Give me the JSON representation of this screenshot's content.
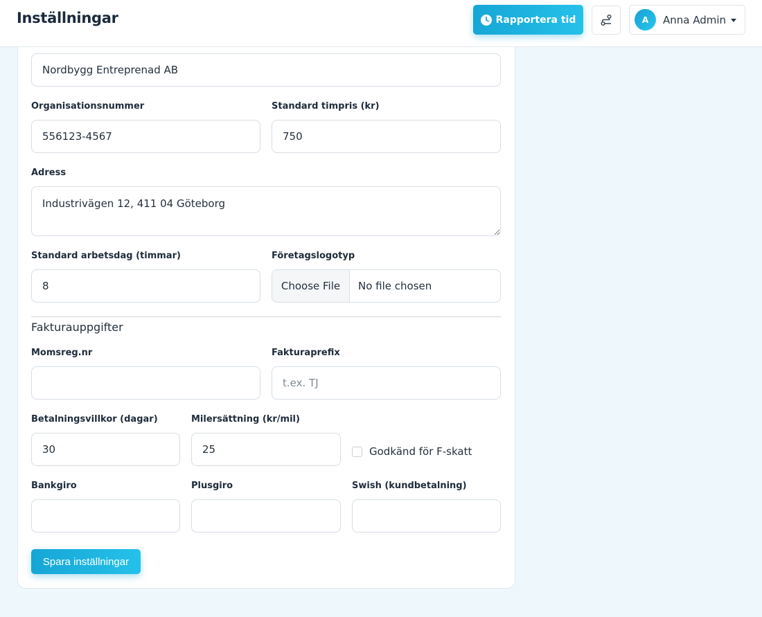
{
  "header": {
    "title": "Inställningar",
    "report_button_label": "Rapportera tid",
    "user": {
      "initial": "A",
      "name": "Anna Admin"
    }
  },
  "company": {
    "name_value": "Nordbygg Entreprenad AB",
    "org_number": {
      "label": "Organisationsnummer",
      "value": "556123-4567"
    },
    "hourly_rate": {
      "label": "Standard timpris (kr)",
      "value": "750"
    },
    "address": {
      "label": "Adress",
      "value": "Industrivägen 12, 411 04 Göteborg"
    },
    "workday_hours": {
      "label": "Standard arbetsdag (timmar)",
      "value": "8"
    },
    "logo": {
      "label": "Företagslogotyp",
      "button_label": "Choose File",
      "status": "No file chosen"
    }
  },
  "invoice": {
    "section_title": "Fakturauppgifter",
    "vat_number": {
      "label": "Momsreg.nr",
      "value": ""
    },
    "invoice_prefix": {
      "label": "Fakturaprefix",
      "value": "",
      "placeholder": "t.ex. TJ"
    },
    "payment_terms": {
      "label": "Betalningsvillkor (dagar)",
      "value": "30"
    },
    "mileage_rate": {
      "label": "Milersättning (kr/mil)",
      "value": "25"
    },
    "f_tax": {
      "label": "Godkänd för F-skatt",
      "checked": false
    },
    "bankgiro": {
      "label": "Bankgiro",
      "value": ""
    },
    "plusgiro": {
      "label": "Plusgiro",
      "value": ""
    },
    "swish": {
      "label": "Swish (kundbetalning)",
      "value": ""
    }
  },
  "save_button_label": "Spara inställningar",
  "colors": {
    "accent": "#1fb3e0",
    "background": "#eef7fc"
  }
}
